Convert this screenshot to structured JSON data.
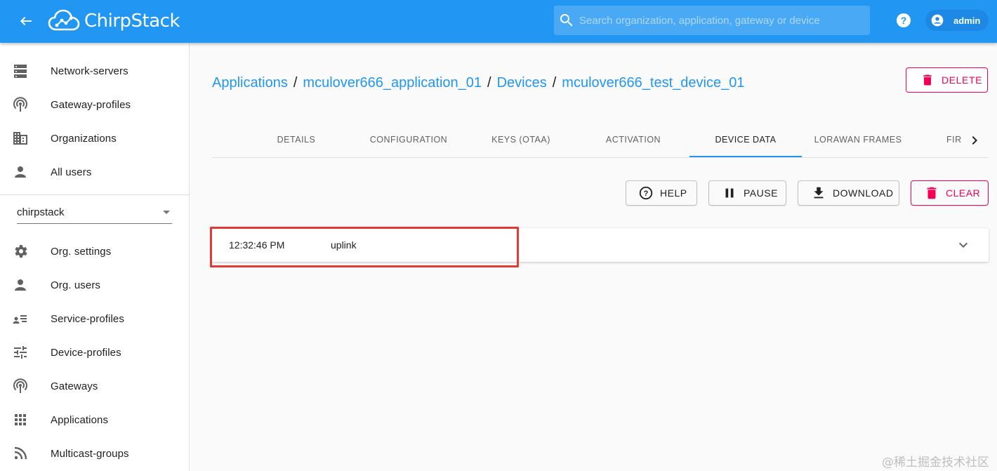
{
  "topbar": {
    "logo_text": "ChirpStack",
    "search_placeholder": "Search organization, application, gateway or device",
    "user_name": "admin",
    "brand_color": "#2196f3"
  },
  "sidebar": {
    "admin_items": [
      {
        "label": "Network-servers",
        "icon": "server-icon"
      },
      {
        "label": "Gateway-profiles",
        "icon": "broadcast-icon"
      },
      {
        "label": "Organizations",
        "icon": "building-icon"
      },
      {
        "label": "All users",
        "icon": "person-icon"
      }
    ],
    "org_select_value": "chirpstack",
    "org_items": [
      {
        "label": "Org. settings",
        "icon": "gear-icon"
      },
      {
        "label": "Org. users",
        "icon": "person-icon"
      },
      {
        "label": "Service-profiles",
        "icon": "list-person-icon"
      },
      {
        "label": "Device-profiles",
        "icon": "tune-icon"
      },
      {
        "label": "Gateways",
        "icon": "broadcast-icon"
      },
      {
        "label": "Applications",
        "icon": "apps-grid-icon"
      },
      {
        "label": "Multicast-groups",
        "icon": "rss-icon"
      }
    ]
  },
  "breadcrumb": {
    "items": [
      "Applications",
      "mculover666_application_01",
      "Devices",
      "mculover666_test_device_01"
    ],
    "separator": "/"
  },
  "delete_label": "DELETE",
  "tabs": {
    "items": [
      "DETAILS",
      "CONFIGURATION",
      "KEYS (OTAA)",
      "ACTIVATION",
      "DEVICE DATA",
      "LORAWAN FRAMES",
      "FIR"
    ],
    "active": "DEVICE DATA"
  },
  "actions": {
    "help": "HELP",
    "pause": "PAUSE",
    "download": "DOWNLOAD",
    "clear": "CLEAR"
  },
  "device_data": {
    "rows": [
      {
        "time": "12:32:46 PM",
        "type": "uplink"
      }
    ]
  },
  "accent_color": "#f50057",
  "watermark": "@稀土掘金技术社区"
}
